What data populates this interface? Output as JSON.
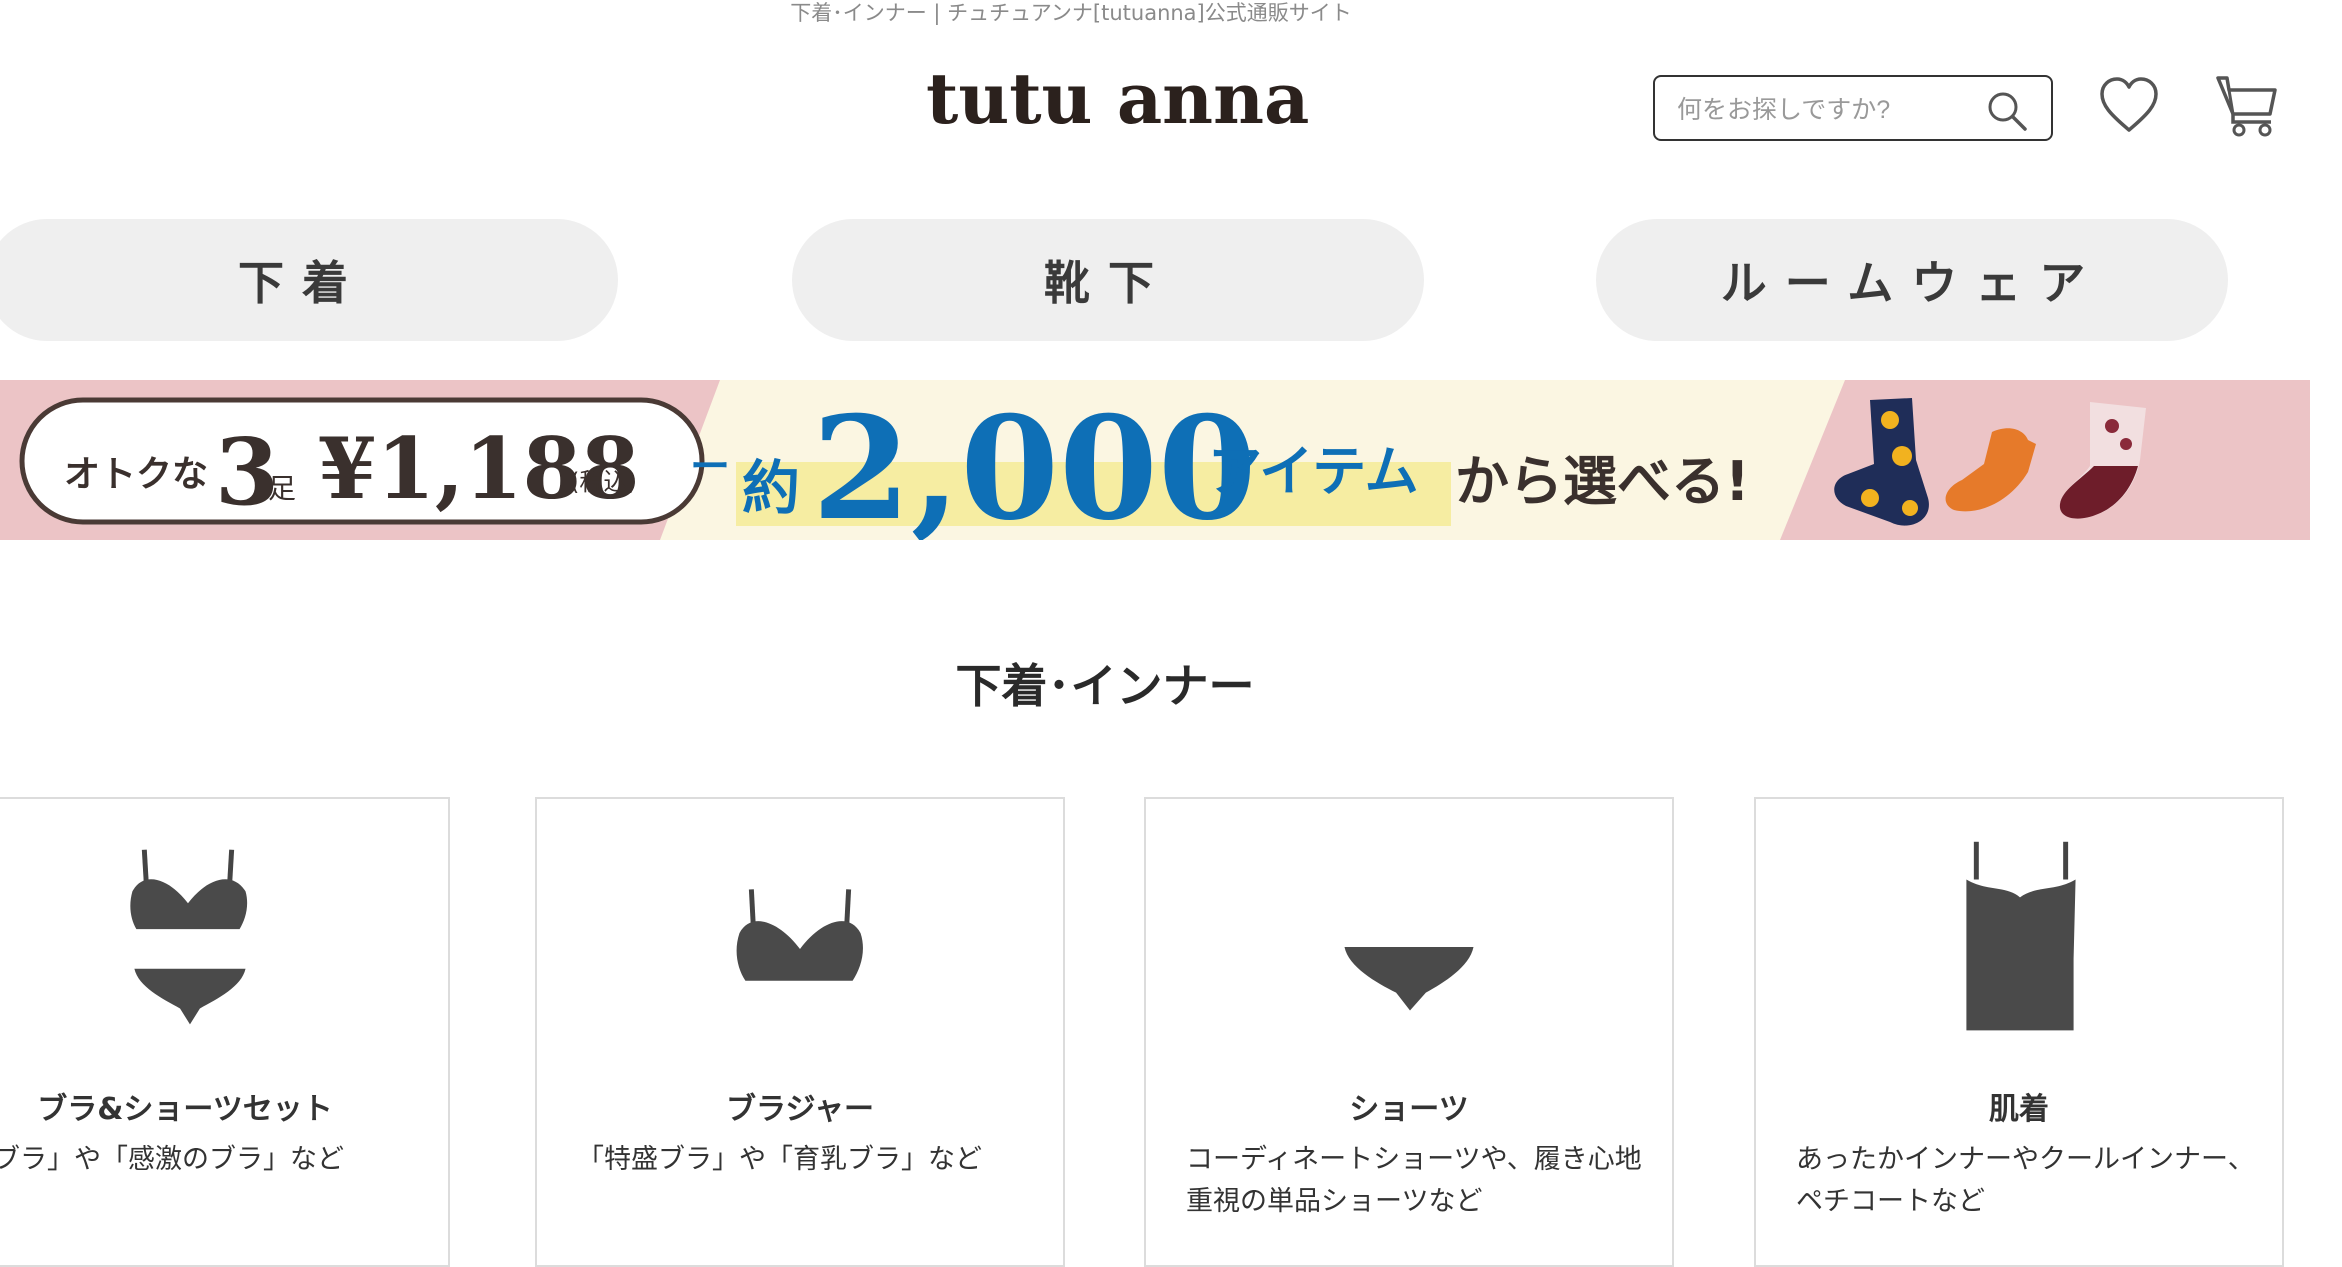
{
  "window_title": "下着･インナー | チュチュアンナ[tutuanna]公式通販サイト",
  "header": {
    "logo_text": "tutu anna",
    "search_placeholder": "何をお探しですか?"
  },
  "category_tabs": [
    "下着",
    "靴下",
    "ルームウェア"
  ],
  "banner": {
    "badge_prefix": "オトクな",
    "badge_count": "3",
    "badge_unit": "足",
    "badge_price": "¥1,188",
    "badge_tax": "(税込)",
    "dash": "ー",
    "about": "約",
    "big_number": "2,000",
    "items_word": "アイテム",
    "suffix": "から選べる!",
    "colors": {
      "pink": "#ecc4c6",
      "cream": "#fbf6e2",
      "blue": "#0e6fb6",
      "highlight": "#f6eda2"
    }
  },
  "section": {
    "title": "下着･インナー"
  },
  "cards": [
    {
      "name": "ブラ&ショーツセット",
      "desc": "運命のブラ」や「感激のブラ」など",
      "icon": "bra-shorts-set-icon"
    },
    {
      "name": "ブラジャー",
      "desc": "「特盛ブラ」や「育乳ブラ」など",
      "icon": "bra-icon"
    },
    {
      "name": "ショーツ",
      "desc": "コーディネートショーツや、履き心地\n重視の単品ショーツなど",
      "icon": "shorts-icon"
    },
    {
      "name": "肌着",
      "desc": "あったかインナーやクールインナー、\nペチコートなど",
      "icon": "camisole-icon"
    }
  ]
}
